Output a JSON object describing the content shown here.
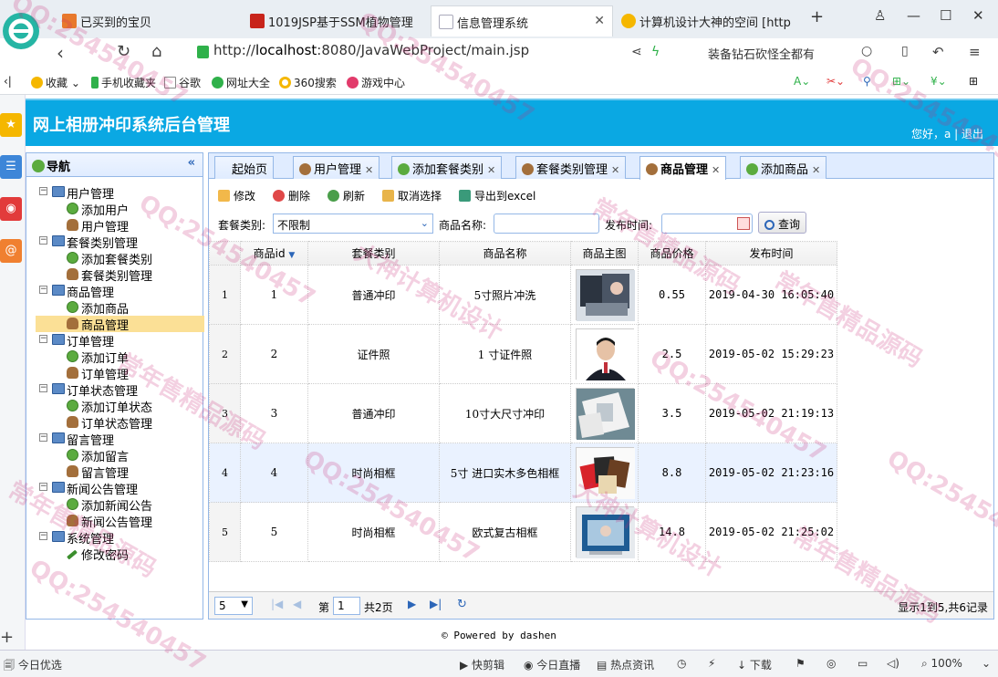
{
  "browser": {
    "tabs": [
      {
        "title": "已买到的宝贝",
        "fav": "#e8782c"
      },
      {
        "title": "1019JSP基于SSM植物管理",
        "fav": "#c8241b"
      },
      {
        "title": "信息管理系统",
        "fav": "#cfd8e0"
      },
      {
        "title": "计算机设计大神的空间 [http",
        "fav": "#f5b700"
      }
    ],
    "url_prefix": "http://",
    "url_host": "localhost",
    "url_rest": ":8080/JavaWebProject/main.jsp",
    "search_text": "装备钻石砍怪全都有",
    "bookmarks": [
      "收藏",
      "手机收藏夹",
      "谷歌",
      "网址大全",
      "360搜索",
      "游戏中心"
    ]
  },
  "app": {
    "title": "网上相册冲印系统后台管理",
    "user_text": "您好，a",
    "logout": "退出"
  },
  "nav": {
    "title": "导航",
    "collapse": "«",
    "groups": [
      {
        "label": "用户管理",
        "items": [
          {
            "label": "添加用户",
            "icon": "add"
          },
          {
            "label": "用户管理",
            "icon": "user"
          }
        ]
      },
      {
        "label": "套餐类别管理",
        "items": [
          {
            "label": "添加套餐类别",
            "icon": "add"
          },
          {
            "label": "套餐类别管理",
            "icon": "user"
          }
        ]
      },
      {
        "label": "商品管理",
        "items": [
          {
            "label": "添加商品",
            "icon": "add"
          },
          {
            "label": "商品管理",
            "icon": "user"
          }
        ]
      },
      {
        "label": "订单管理",
        "items": [
          {
            "label": "添加订单",
            "icon": "add"
          },
          {
            "label": "订单管理",
            "icon": "user"
          }
        ]
      },
      {
        "label": "订单状态管理",
        "items": [
          {
            "label": "添加订单状态",
            "icon": "add"
          },
          {
            "label": "订单状态管理",
            "icon": "user"
          }
        ]
      },
      {
        "label": "留言管理",
        "items": [
          {
            "label": "添加留言",
            "icon": "add"
          },
          {
            "label": "留言管理",
            "icon": "user"
          }
        ]
      },
      {
        "label": "新闻公告管理",
        "items": [
          {
            "label": "添加新闻公告",
            "icon": "add"
          },
          {
            "label": "新闻公告管理",
            "icon": "user"
          }
        ]
      },
      {
        "label": "系统管理",
        "items": [
          {
            "label": "修改密码",
            "icon": "pen"
          }
        ]
      }
    ]
  },
  "tabs": [
    {
      "label": "起始页",
      "icon": "none"
    },
    {
      "label": "用户管理",
      "icon": "user"
    },
    {
      "label": "添加套餐类别",
      "icon": "add"
    },
    {
      "label": "套餐类别管理",
      "icon": "user"
    },
    {
      "label": "商品管理",
      "icon": "user"
    },
    {
      "label": "添加商品",
      "icon": "add"
    }
  ],
  "toolbar": {
    "edit": "修改",
    "delete": "删除",
    "refresh": "刷新",
    "cancel_select": "取消选择",
    "export": "导出到excel"
  },
  "filters": {
    "category_label": "套餐类别:",
    "category_value": "不限制",
    "name_label": "商品名称:",
    "date_label": "发布时间:",
    "query": "查询"
  },
  "table": {
    "columns": [
      "商品id",
      "套餐类别",
      "商品名称",
      "商品主图",
      "商品价格",
      "发布时间"
    ],
    "rows": [
      {
        "rn": "1",
        "id": "1",
        "cat": "普通冲印",
        "name": "5寸照片冲洗",
        "price": "0.55",
        "time": "2019-04-30 16:05:40",
        "img": "photos"
      },
      {
        "rn": "2",
        "id": "2",
        "cat": "证件照",
        "name": "1 寸证件照",
        "price": "2.5",
        "time": "2019-05-02 15:29:23",
        "img": "portrait"
      },
      {
        "rn": "3",
        "id": "3",
        "cat": "普通冲印",
        "name": "10寸大尺寸冲印",
        "price": "3.5",
        "time": "2019-05-02 21:19:13",
        "img": "prints"
      },
      {
        "rn": "4",
        "id": "4",
        "cat": "时尚相框",
        "name": "5寸 进口实木多色相框",
        "price": "8.8",
        "time": "2019-05-02 21:23:16",
        "img": "frames"
      },
      {
        "rn": "5",
        "id": "5",
        "cat": "时尚相框",
        "name": "欧式复古相框",
        "price": "14.8",
        "time": "2019-05-02 21:25:02",
        "img": "bluframe"
      }
    ]
  },
  "pager": {
    "page_size": "5",
    "page_prefix": "第",
    "page_num": "1",
    "page_total": "共2页",
    "summary": "显示1到5,共6记录"
  },
  "footer": "© Powered by dashen",
  "statusbar": [
    "今日优选",
    "快剪辑",
    "今日直播",
    "热点资讯",
    "下载",
    "100%"
  ],
  "watermarks": [
    "QQ:254540457",
    "常年售精品源码",
    "大神计算机设计"
  ]
}
